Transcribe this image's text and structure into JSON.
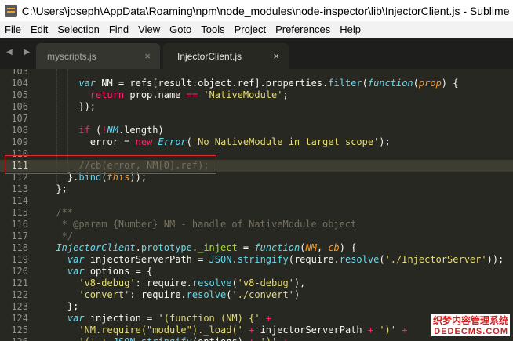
{
  "window": {
    "title": "C:\\Users\\joseph\\AppData\\Roaming\\npm\\node_modules\\node-inspector\\lib\\InjectorClient.js - Sublime ..."
  },
  "menu": [
    "File",
    "Edit",
    "Selection",
    "Find",
    "View",
    "Goto",
    "Tools",
    "Project",
    "Preferences",
    "Help"
  ],
  "tabs": [
    {
      "label": "myscripts.js",
      "close": "×",
      "active": false
    },
    {
      "label": "InjectorClient.js",
      "close": "×",
      "active": true
    }
  ],
  "nav_arrows": "◀ ▶",
  "line_numbers": [
    "103",
    "104",
    "105",
    "106",
    "107",
    "108",
    "109",
    "110",
    "111",
    "112",
    "113",
    "114",
    "115",
    "116",
    "117",
    "118",
    "119",
    "120",
    "121",
    "122",
    "123",
    "124",
    "125",
    "126"
  ],
  "watermark": {
    "line1": "织梦内容管理系统",
    "line2": "DEDECMS.COM"
  },
  "colors": {
    "background": "#272822",
    "keyword": "#f92672",
    "string": "#e6db74",
    "function": "#66d9ef",
    "param": "#fd971f",
    "comment": "#75715e",
    "highlight_box": "#d93030"
  }
}
